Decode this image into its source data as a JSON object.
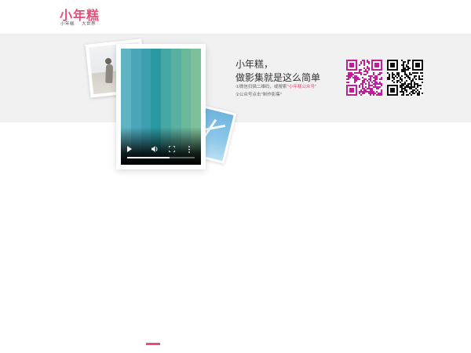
{
  "header": {
    "logo_text": "小年糕",
    "logo_subtitle": "小年糕    大世界"
  },
  "promo": {
    "headline_line1": "小年糕，",
    "headline_line2": "做影集就是这么简单",
    "step1_prefix": "①微信扫描二维码，或搜索",
    "step1_highlight": "\"小年糕公众号\"",
    "step2": "②公众号点击\"制作影集\""
  },
  "video": {
    "play_icon": "play-icon",
    "volume_icon": "volume-icon",
    "fullscreen_icon": "fullscreen-icon",
    "more_icon": "more-options-icon",
    "progress_fraction": 0.63
  },
  "qr_codes": [
    {
      "color": "#c21e9a",
      "icon": "qr-code-pink"
    },
    {
      "color": "#111111",
      "icon": "qr-code-black"
    }
  ],
  "colors": {
    "brand": "#e84e7a",
    "band_bg": "#f1f1f1",
    "stripes": [
      "#5fb3c2",
      "#4aa6bb",
      "#3d9fb0",
      "#2a9aa0",
      "#46a8a4",
      "#59b0a0",
      "#6bb89b",
      "#7dc09a"
    ]
  }
}
